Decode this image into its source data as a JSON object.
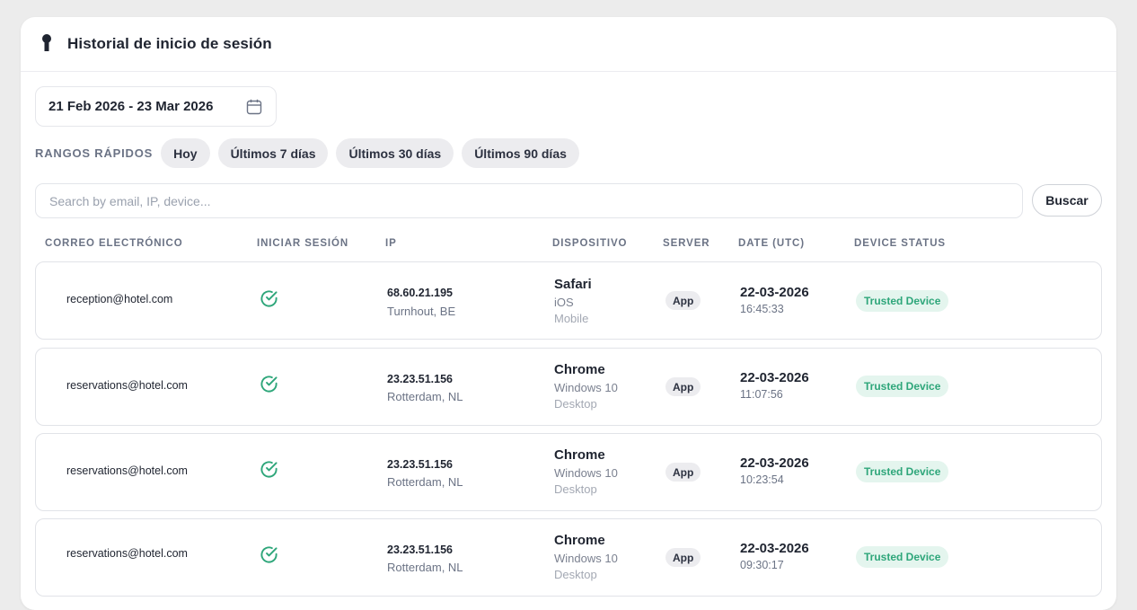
{
  "header": {
    "title": "Historial de inicio de sesión",
    "icon": "key-icon"
  },
  "filters": {
    "date_range": "21 Feb 2026 - 23 Mar 2026",
    "quick_ranges_label": "RANGOS RÁPIDOS",
    "quick_ranges": [
      "Hoy",
      "Últimos 7 días",
      "Últimos 30 días",
      "Últimos 90 días"
    ]
  },
  "search": {
    "placeholder": "Search by email, IP, device...",
    "value": "",
    "button_label": "Buscar"
  },
  "table": {
    "columns": [
      "CORREO ELECTRÓNICO",
      "INICIAR SESIÓN",
      "IP",
      "DISPOSITIVO",
      "SERVER",
      "DATE (UTC)",
      "DEVICE STATUS"
    ],
    "rows": [
      {
        "email": "reception@hotel.com",
        "login_success": true,
        "ip": "68.60.21.195",
        "location": "Turnhout, BE",
        "browser": "Safari",
        "os": "iOS",
        "device_type": "Mobile",
        "server": "App",
        "date": "22-03-2026",
        "time": "16:45:33",
        "status": "Trusted Device"
      },
      {
        "email": "reservations@hotel.com",
        "login_success": true,
        "ip": "23.23.51.156",
        "location": "Rotterdam, NL",
        "browser": "Chrome",
        "os": "Windows 10",
        "device_type": "Desktop",
        "server": "App",
        "date": "22-03-2026",
        "time": "11:07:56",
        "status": "Trusted Device"
      },
      {
        "email": "reservations@hotel.com",
        "login_success": true,
        "ip": "23.23.51.156",
        "location": "Rotterdam, NL",
        "browser": "Chrome",
        "os": "Windows 10",
        "device_type": "Desktop",
        "server": "App",
        "date": "22-03-2026",
        "time": "10:23:54",
        "status": "Trusted Device"
      },
      {
        "email": "reservations@hotel.com",
        "login_success": true,
        "ip": "23.23.51.156",
        "location": "Rotterdam, NL",
        "browser": "Chrome",
        "os": "Windows 10",
        "device_type": "Desktop",
        "server": "App",
        "date": "22-03-2026",
        "time": "09:30:17",
        "status": "Trusted Device"
      }
    ]
  },
  "colors": {
    "success": "#2ea67a",
    "success_bg": "#e4f5ee",
    "chip_bg": "#ececef",
    "muted_text": "#6b7385"
  }
}
